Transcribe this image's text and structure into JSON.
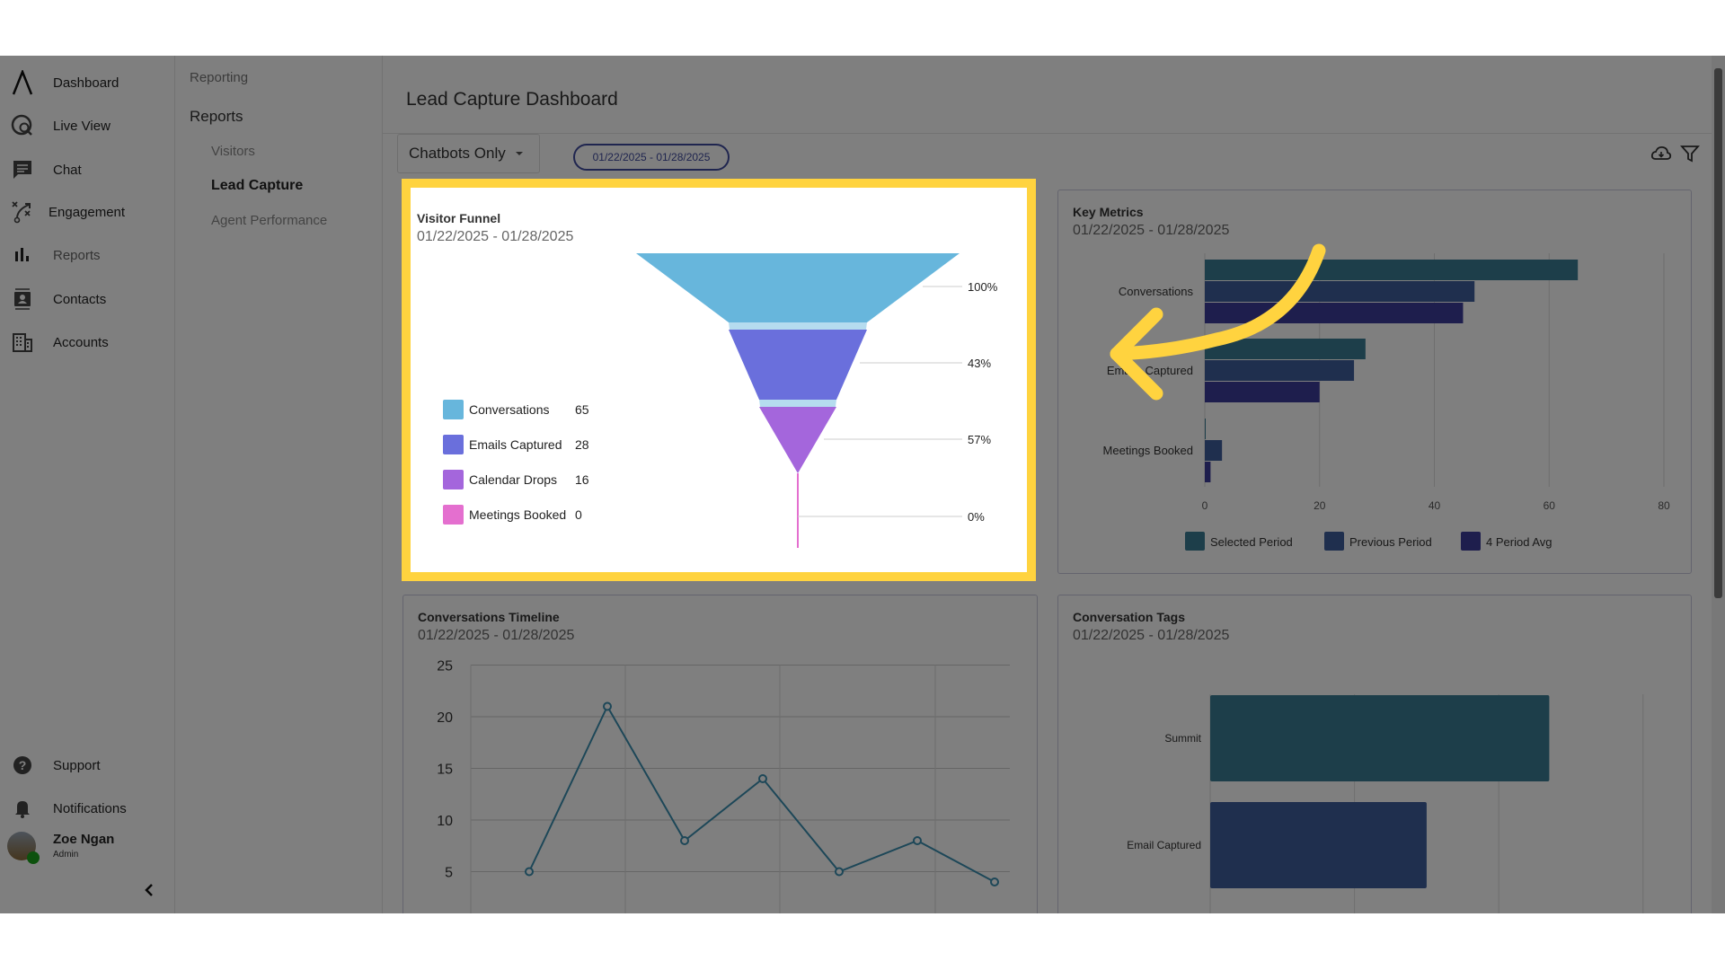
{
  "sidebar": {
    "items": [
      {
        "label": "Dashboard",
        "icon": "logo-icon"
      },
      {
        "label": "Live View",
        "icon": "globe-search-icon"
      },
      {
        "label": "Chat",
        "icon": "chat-icon"
      },
      {
        "label": "Engagement",
        "icon": "route-icon"
      },
      {
        "label": "Reports",
        "icon": "bar-chart-icon"
      },
      {
        "label": "Contacts",
        "icon": "contact-card-icon"
      },
      {
        "label": "Accounts",
        "icon": "building-icon"
      }
    ],
    "support": "Support",
    "notifications": "Notifications",
    "user": {
      "name": "Zoe Ngan",
      "role": "Admin",
      "status_color": "#1aa31a"
    }
  },
  "subnav": {
    "section": "Reporting",
    "heading": "Reports",
    "items": [
      "Visitors",
      "Lead Capture",
      "Agent Performance"
    ],
    "active": "Lead Capture"
  },
  "header": {
    "title": "Lead Capture Dashboard",
    "filter_select": "Chatbots Only",
    "date_range": "01/22/2025 - 01/28/2025"
  },
  "colors": {
    "highlight": "#ffd33f",
    "accent": "#3f4a9e"
  },
  "funnel": {
    "title": "Visitor Funnel",
    "date": "01/22/2025 - 01/28/2025",
    "stages": [
      {
        "label": "Conversations",
        "value": "65",
        "pct": "100%",
        "color": "#67b6dc"
      },
      {
        "label": "Emails Captured",
        "value": "28",
        "pct": "43%",
        "color": "#6a6fdc"
      },
      {
        "label": "Calendar Drops",
        "value": "16",
        "pct": "57%",
        "color": "#a466dc"
      },
      {
        "label": "Meetings Booked",
        "value": "0",
        "pct": "0%",
        "color": "#e46fcf"
      }
    ]
  },
  "chart_data": [
    {
      "type": "bar",
      "orientation": "horizontal",
      "title": "Key Metrics",
      "subtitle": "01/22/2025 - 01/28/2025",
      "categories": [
        "Conversations",
        "Emails Captured",
        "Meetings Booked"
      ],
      "series": [
        {
          "name": "Selected Period",
          "values": [
            65,
            28,
            0
          ],
          "color": "#3a7c94"
        },
        {
          "name": "Previous Period",
          "values": [
            47,
            26,
            3
          ],
          "color": "#3e5e9c"
        },
        {
          "name": "4 Period Avg",
          "values": [
            45,
            20,
            1
          ],
          "color": "#3c3c9a"
        }
      ],
      "xlim": [
        0,
        80
      ],
      "ticks": [
        "0",
        "20",
        "40",
        "60",
        "80"
      ],
      "grid": true,
      "legend": "bottom"
    },
    {
      "type": "line",
      "title": "Conversations Timeline",
      "subtitle": "01/22/2025 - 01/28/2025",
      "values": [
        5,
        21,
        8,
        14,
        5,
        8,
        4
      ],
      "ylim": [
        0,
        25
      ],
      "yticks": [
        "25",
        "20",
        "15",
        "10",
        "5"
      ],
      "grid": true,
      "color": "#3a8fb0"
    },
    {
      "type": "bar",
      "orientation": "horizontal",
      "title": "Conversation Tags",
      "subtitle": "01/22/2025 - 01/28/2025",
      "categories": [
        "Summit",
        "Email Captured"
      ],
      "values": [
        47,
        30
      ],
      "colors": [
        "#3a7c94",
        "#3e5e9c"
      ],
      "xlim": [
        0,
        60
      ],
      "grid": true
    }
  ]
}
